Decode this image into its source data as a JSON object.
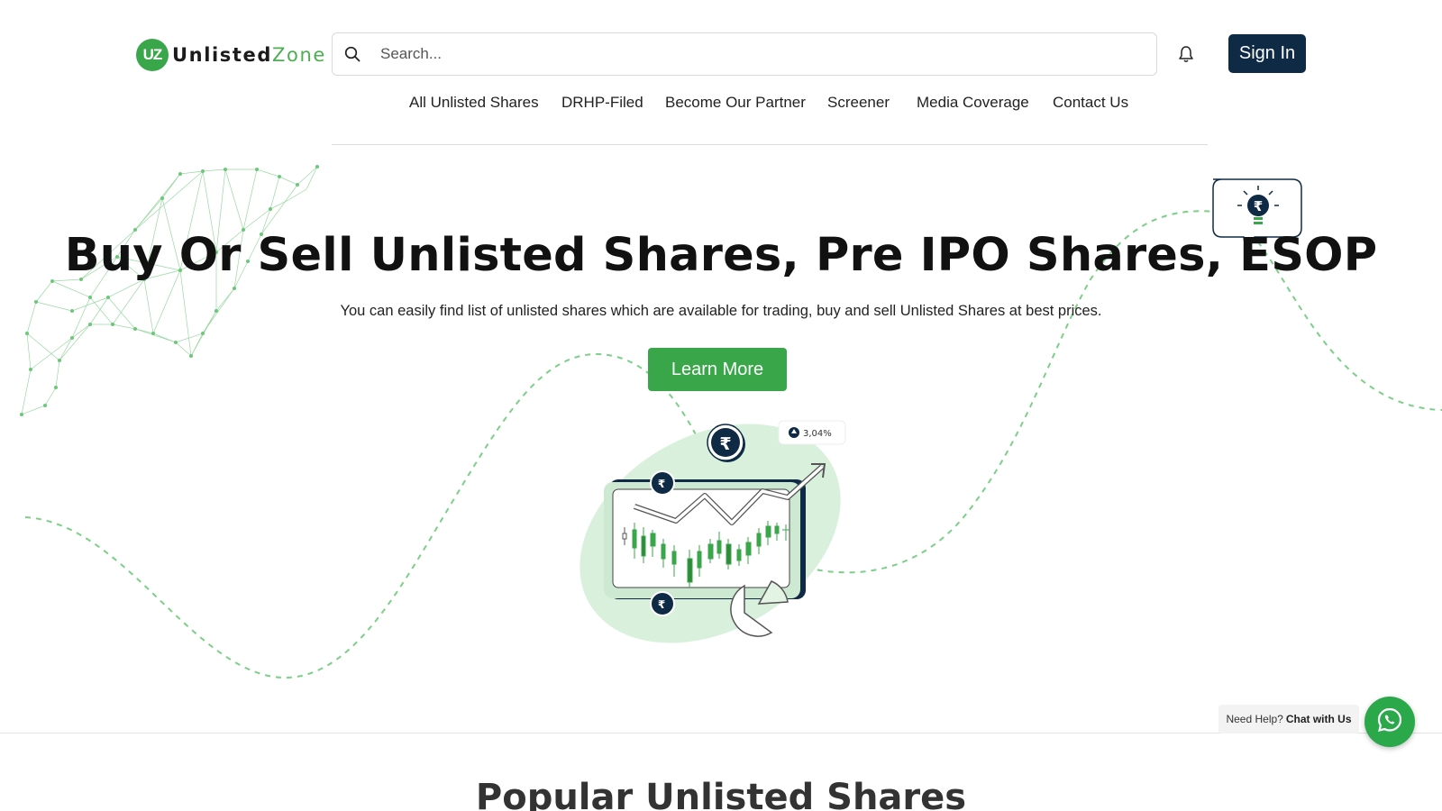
{
  "brand": {
    "name_part1": "Unlisted",
    "name_part2": "Zone",
    "mark": "UZ",
    "accent_color": "#3aa64a",
    "dark_color": "#0f2a45"
  },
  "header": {
    "search": {
      "placeholder": "Search...",
      "value": ""
    },
    "signin_label": "Sign In",
    "icons": [
      "search-icon",
      "bell-icon"
    ]
  },
  "nav": {
    "items": [
      {
        "label": "All Unlisted Shares"
      },
      {
        "label": "DRHP-Filed"
      },
      {
        "label": "Become Our Partner"
      },
      {
        "label": "Screener"
      },
      {
        "label": "Media Coverage"
      },
      {
        "label": "Contact Us"
      }
    ]
  },
  "hero": {
    "title": "Buy Or Sell Unlisted Shares, Pre IPO Shares, ESOP",
    "subtitle": "You can easily find list of unlisted shares which are available for trading, buy and sell Unlisted Shares at best prices.",
    "cta_label": "Learn More",
    "illustration": {
      "badge_text": "3,04%",
      "coin_symbol": "₹"
    }
  },
  "section": {
    "title": "Popular Unlisted Shares"
  },
  "chat": {
    "prefix": "Need Help?",
    "link": "Chat with Us",
    "icon": "whatsapp-icon"
  }
}
